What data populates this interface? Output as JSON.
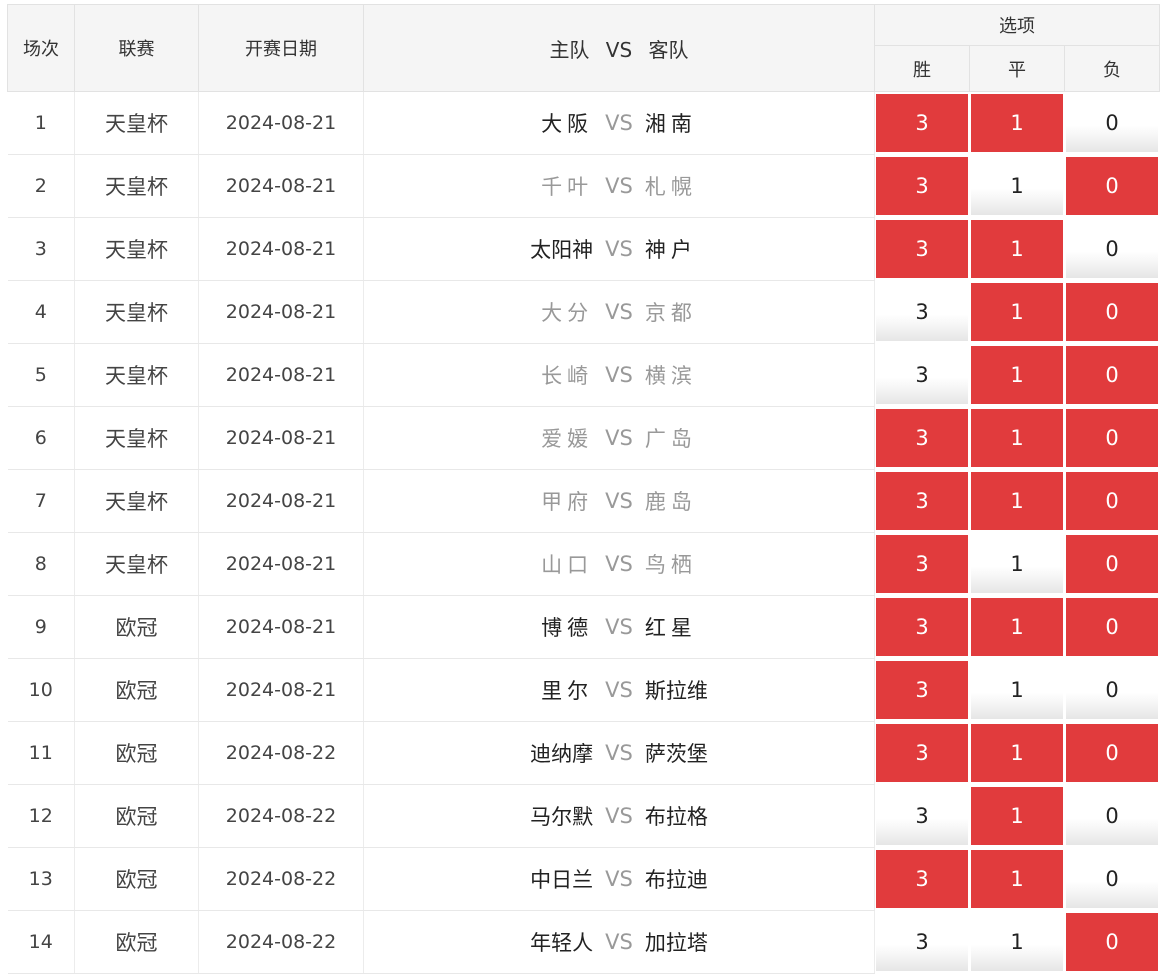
{
  "header": {
    "idx": "场次",
    "league": "联赛",
    "date": "开赛日期",
    "home": "主队",
    "vs": "VS",
    "away": "客队",
    "options": "选项",
    "win": "胜",
    "draw": "平",
    "lose": "负"
  },
  "accent_color": "#e13b3d",
  "rows": [
    {
      "idx": "1",
      "league": "天皇杯",
      "date": "2024-08-21",
      "home": "大阪",
      "away": "湘南",
      "vs": "VS",
      "dim": false,
      "w": "3",
      "d": "1",
      "l": "0",
      "sel": [
        true,
        true,
        false
      ]
    },
    {
      "idx": "2",
      "league": "天皇杯",
      "date": "2024-08-21",
      "home": "千叶",
      "away": "札幌",
      "vs": "VS",
      "dim": true,
      "w": "3",
      "d": "1",
      "l": "0",
      "sel": [
        true,
        false,
        true
      ]
    },
    {
      "idx": "3",
      "league": "天皇杯",
      "date": "2024-08-21",
      "home": "太阳神",
      "away": "神户",
      "vs": "VS",
      "dim": false,
      "w": "3",
      "d": "1",
      "l": "0",
      "sel": [
        true,
        true,
        false
      ]
    },
    {
      "idx": "4",
      "league": "天皇杯",
      "date": "2024-08-21",
      "home": "大分",
      "away": "京都",
      "vs": "VS",
      "dim": true,
      "w": "3",
      "d": "1",
      "l": "0",
      "sel": [
        false,
        true,
        true
      ]
    },
    {
      "idx": "5",
      "league": "天皇杯",
      "date": "2024-08-21",
      "home": "长崎",
      "away": "横滨",
      "vs": "VS",
      "dim": true,
      "w": "3",
      "d": "1",
      "l": "0",
      "sel": [
        false,
        true,
        true
      ]
    },
    {
      "idx": "6",
      "league": "天皇杯",
      "date": "2024-08-21",
      "home": "爱媛",
      "away": "广岛",
      "vs": "VS",
      "dim": true,
      "w": "3",
      "d": "1",
      "l": "0",
      "sel": [
        true,
        true,
        true
      ]
    },
    {
      "idx": "7",
      "league": "天皇杯",
      "date": "2024-08-21",
      "home": "甲府",
      "away": "鹿岛",
      "vs": "VS",
      "dim": true,
      "w": "3",
      "d": "1",
      "l": "0",
      "sel": [
        true,
        true,
        true
      ]
    },
    {
      "idx": "8",
      "league": "天皇杯",
      "date": "2024-08-21",
      "home": "山口",
      "away": "鸟栖",
      "vs": "VS",
      "dim": true,
      "w": "3",
      "d": "1",
      "l": "0",
      "sel": [
        true,
        false,
        true
      ]
    },
    {
      "idx": "9",
      "league": "欧冠",
      "date": "2024-08-21",
      "home": "博德",
      "away": "红星",
      "vs": "VS",
      "dim": false,
      "w": "3",
      "d": "1",
      "l": "0",
      "sel": [
        true,
        true,
        true
      ]
    },
    {
      "idx": "10",
      "league": "欧冠",
      "date": "2024-08-21",
      "home": "里尔",
      "away": "斯拉维",
      "vs": "VS",
      "dim": false,
      "w": "3",
      "d": "1",
      "l": "0",
      "sel": [
        true,
        false,
        false
      ]
    },
    {
      "idx": "11",
      "league": "欧冠",
      "date": "2024-08-22",
      "home": "迪纳摩",
      "away": "萨茨堡",
      "vs": "VS",
      "dim": false,
      "w": "3",
      "d": "1",
      "l": "0",
      "sel": [
        true,
        true,
        true
      ]
    },
    {
      "idx": "12",
      "league": "欧冠",
      "date": "2024-08-22",
      "home": "马尔默",
      "away": "布拉格",
      "vs": "VS",
      "dim": false,
      "w": "3",
      "d": "1",
      "l": "0",
      "sel": [
        false,
        true,
        false
      ]
    },
    {
      "idx": "13",
      "league": "欧冠",
      "date": "2024-08-22",
      "home": "中日兰",
      "away": "布拉迪",
      "vs": "VS",
      "dim": false,
      "w": "3",
      "d": "1",
      "l": "0",
      "sel": [
        true,
        true,
        false
      ]
    },
    {
      "idx": "14",
      "league": "欧冠",
      "date": "2024-08-22",
      "home": "年轻人",
      "away": "加拉塔",
      "vs": "VS",
      "dim": false,
      "w": "3",
      "d": "1",
      "l": "0",
      "sel": [
        false,
        false,
        true
      ]
    }
  ]
}
